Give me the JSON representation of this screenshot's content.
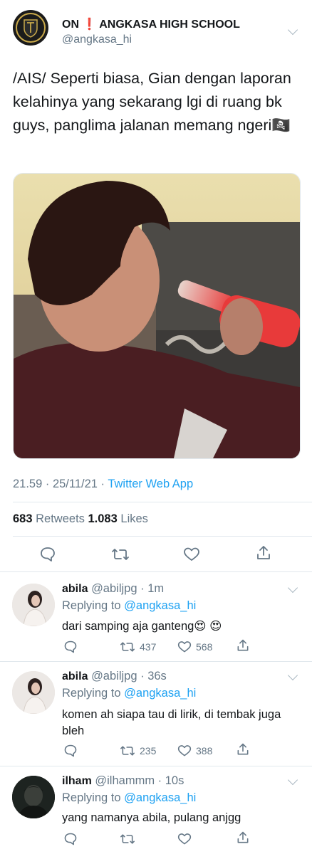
{
  "main": {
    "display_name_prefix": "ON",
    "display_name_icon": "❗",
    "display_name_rest": "ANGKASA HIGH SCHOOL",
    "handle": "@angkasa_hi",
    "text": "/AIS/ Seperti biasa, Gian dengan laporan kelahinya yang sekarang lgi di ruang bk guys, panglima jalanan memang ngeri🏴‍☠️",
    "timestamp": "21.59 · 25/11/21 · ",
    "client": "Twitter Web App",
    "retweets_count": "683",
    "retweets_label": "Retweets",
    "likes_count": "1.083",
    "likes_label": "Likes"
  },
  "replies": [
    {
      "name": "abila",
      "handle": "@abiljpg",
      "time": "· 1m",
      "replying_prefix": "Replying to ",
      "replying_to": "@angkasa_hi",
      "text": "dari samping aja ganteng😍 😍",
      "retweets": "437",
      "likes": "568"
    },
    {
      "name": "abila",
      "handle": "@abiljpg",
      "time": "· 36s",
      "replying_prefix": "Replying to ",
      "replying_to": "@angkasa_hi",
      "text": "komen ah siapa tau di lirik, di tembak juga bleh",
      "retweets": "235",
      "likes": "388"
    },
    {
      "name": "ilham",
      "handle": "@ilhammm",
      "time": "· 10s",
      "replying_prefix": "Replying to ",
      "replying_to": "@angkasa_hi",
      "text": "yang namanya abila, pulang anjgg",
      "retweets": "",
      "likes": ""
    }
  ],
  "colors": {
    "accent": "#1da1f2",
    "muted": "#657786",
    "divider": "#e1e8ed"
  }
}
